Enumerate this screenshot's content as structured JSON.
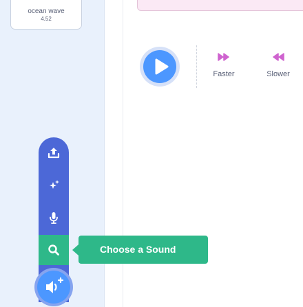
{
  "sound_list": {
    "item": {
      "name": "ocean wave",
      "duration": "4.52"
    }
  },
  "playback": {
    "play_icon": "play-icon",
    "effects": [
      {
        "label": "Faster",
        "icon": "faster-icon",
        "color": "#cf63cf"
      },
      {
        "label": "Slower",
        "icon": "slower-icon",
        "color": "#cf63cf"
      }
    ]
  },
  "add_sound_menu": {
    "items": [
      {
        "icon": "upload-icon",
        "name": "upload-sound"
      },
      {
        "icon": "surprise-icon",
        "name": "surprise"
      },
      {
        "icon": "microphone-icon",
        "name": "record"
      },
      {
        "icon": "search-icon",
        "name": "choose-sound",
        "active": true
      }
    ],
    "main_icon": "add-sound-icon",
    "tooltip": "Choose a Sound"
  },
  "colors": {
    "menu_blue": "#4c68d7",
    "accent_green": "#2eb889",
    "play_blue": "#4c97ff",
    "effect_magenta": "#cf63cf"
  }
}
